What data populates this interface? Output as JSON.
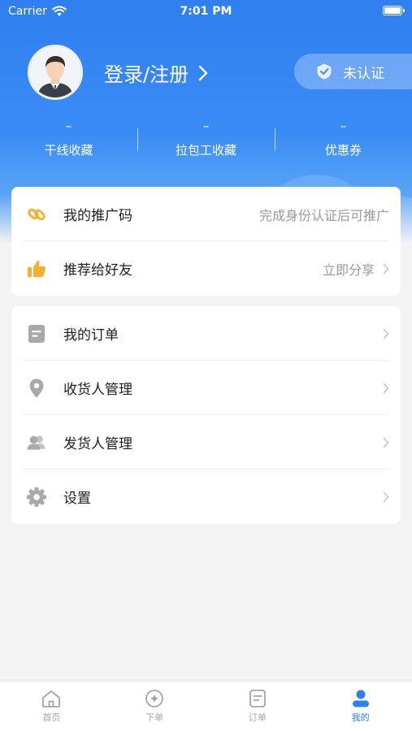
{
  "status_bar": {
    "carrier": "Carrier",
    "time": "7:01 PM"
  },
  "profile": {
    "login_text": "登录/注册",
    "cert_label": "未认证"
  },
  "stats": [
    {
      "value": "–",
      "label": "干线收藏"
    },
    {
      "value": "–",
      "label": "拉包工收藏"
    },
    {
      "value": "–",
      "label": "优惠券"
    }
  ],
  "promo": {
    "items": [
      {
        "label": "我的推广码",
        "right_text": "完成身份认证后可推广",
        "icon": "link-icon"
      },
      {
        "label": "推荐给好友",
        "right_text": "立即分享",
        "icon": "thumbs-up-icon"
      }
    ]
  },
  "menu": {
    "items": [
      {
        "label": "我的订单",
        "icon": "document-icon"
      },
      {
        "label": "收货人管理",
        "icon": "location-pin-icon"
      },
      {
        "label": "发货人管理",
        "icon": "people-icon"
      },
      {
        "label": "设置",
        "icon": "gear-icon"
      }
    ]
  },
  "tabbar": {
    "active_index": 3,
    "accent_color": "#2f7ff0",
    "inactive_color": "#a6a6a6",
    "items": [
      {
        "label": "首页",
        "icon": "home-icon"
      },
      {
        "label": "下单",
        "icon": "compass-icon"
      },
      {
        "label": "订单",
        "icon": "order-list-icon"
      },
      {
        "label": "我的",
        "icon": "user-icon"
      }
    ]
  }
}
